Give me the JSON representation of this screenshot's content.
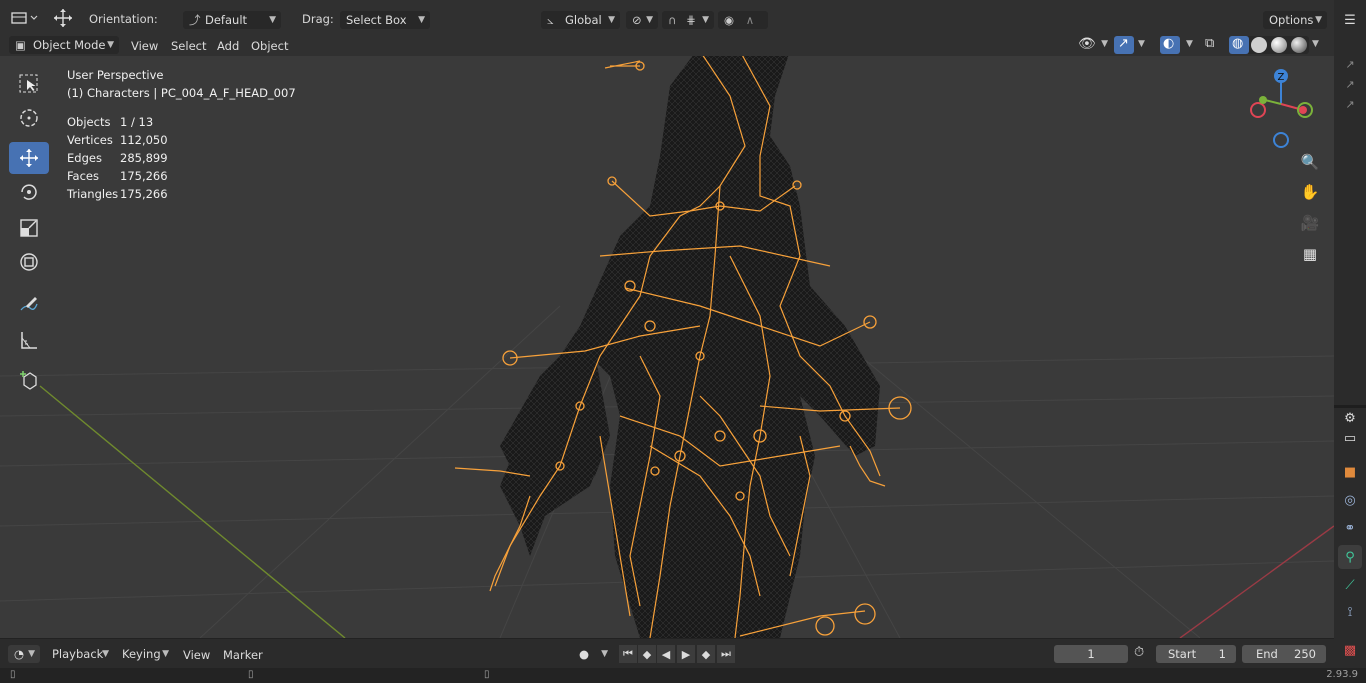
{
  "header": {
    "orientation_label": "Orientation:",
    "orientation_value": "Default",
    "drag_label": "Drag:",
    "drag_value": "Select Box",
    "transform_space": "Global",
    "options_label": "Options"
  },
  "menu": {
    "mode": "Object Mode",
    "view": "View",
    "select": "Select",
    "add": "Add",
    "object": "Object"
  },
  "viewport": {
    "perspective": "User Perspective",
    "collection": "(1) Characters | PC_004_A_F_HEAD_007",
    "stats": [
      {
        "key": "Objects",
        "value": "1 / 13"
      },
      {
        "key": "Vertices",
        "value": "112,050"
      },
      {
        "key": "Edges",
        "value": "285,899"
      },
      {
        "key": "Faces",
        "value": "175,266"
      },
      {
        "key": "Triangles",
        "value": "175,266"
      }
    ],
    "gizmo": {
      "z_label": "Z"
    }
  },
  "timeline": {
    "playback": "Playback",
    "keying": "Keying",
    "view": "View",
    "marker": "Marker",
    "current_frame": "1",
    "start_label": "Start",
    "start_value": "1",
    "end_label": "End",
    "end_value": "250"
  },
  "status": {
    "version": "2.93.9"
  },
  "colors": {
    "accent": "#4772b3",
    "bone": "#f7a13a",
    "mesh": "#111111",
    "x_axis": "#e04555",
    "y_axis": "#7bb23a",
    "z_axis": "#3d83d6"
  }
}
